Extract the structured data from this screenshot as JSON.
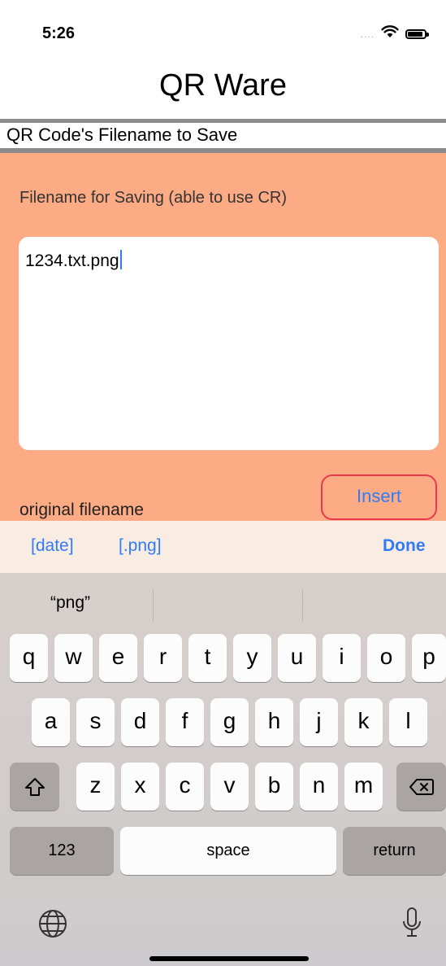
{
  "status_bar": {
    "time": "5:26",
    "signal": "....",
    "battery_level": 0.9
  },
  "app": {
    "title": "QR Ware"
  },
  "section": {
    "label": "QR Code's Filename to Save"
  },
  "form": {
    "field_label": "Filename for Saving (able to use CR)",
    "filename_value": "1234.txt.png",
    "original_label": "original filename",
    "insert_button": "Insert"
  },
  "accessory_bar": {
    "date_button": "[date]",
    "png_button": "[.png]",
    "done_button": "Done"
  },
  "keyboard": {
    "suggestions": [
      "“png”",
      "",
      ""
    ],
    "row1": [
      "q",
      "w",
      "e",
      "r",
      "t",
      "y",
      "u",
      "i",
      "o",
      "p"
    ],
    "row2": [
      "a",
      "s",
      "d",
      "f",
      "g",
      "h",
      "j",
      "k",
      "l"
    ],
    "row3": [
      "z",
      "x",
      "c",
      "v",
      "b",
      "n",
      "m"
    ],
    "numbers_key": "123",
    "space_key": "space",
    "return_key": "return"
  },
  "colors": {
    "accent": "#2f7cf6",
    "form_background": "#fdab84",
    "insert_border": "#e8394d"
  },
  "icons": [
    "wifi-icon",
    "battery-icon",
    "shift-icon",
    "backspace-icon",
    "globe-icon",
    "microphone-icon"
  ]
}
